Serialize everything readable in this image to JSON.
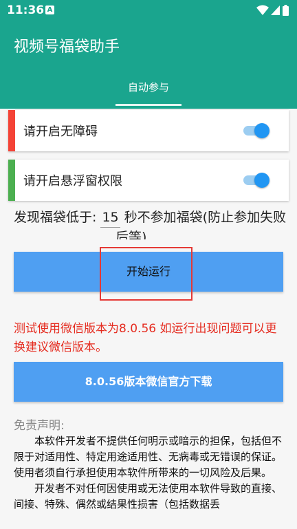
{
  "status_bar": {
    "time": "11:36",
    "notification_letter": "A",
    "icons": [
      "wifi-icon",
      "signal-icon",
      "battery-icon"
    ]
  },
  "app": {
    "title": "视频号福袋助手",
    "tabs": [
      {
        "label": "自动参与",
        "active": true
      }
    ]
  },
  "permissions": [
    {
      "label": "请开启无障碍",
      "stripe_color": "#f44336",
      "enabled": true
    },
    {
      "label": "请开启悬浮窗权限",
      "stripe_color": "#4caf50",
      "enabled": true
    }
  ],
  "threshold": {
    "prefix": "发现福袋低于: ",
    "value": "15",
    "suffix": " 秒不参加福袋(防止参加失败",
    "clipped_line": "后等)"
  },
  "start_button": {
    "label": "开始运行"
  },
  "warning_text": "测试使用微信版本为8.0.56 如运行出现问题可以更换建议微信版本。",
  "download_button": {
    "label": "8.0.56版本微信官方下载"
  },
  "disclaimer": {
    "title": "免责声明:",
    "paragraphs": [
      "本软件开发者不提供任何明示或暗示的担保，包括但不限于对适用性、特定用途适用性、无病毒或无错误的保证。使用者须自行承担使用本软件所带来的一切风险及后果。",
      "开发者不对任何因使用或无法使用本软件导致的直接、间接、特殊、偶然或结果性损害（包括数据丢"
    ]
  },
  "colors": {
    "app_bar": "#1aa58e",
    "button": "#4f9ff2",
    "toggle_on": "#2196f3",
    "warning": "#e52b1f"
  }
}
